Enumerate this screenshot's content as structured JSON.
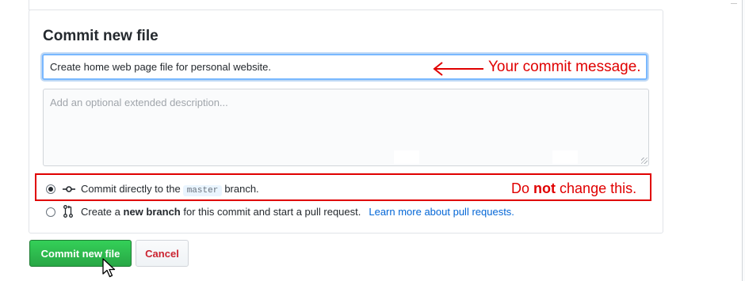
{
  "form": {
    "title": "Commit new file",
    "message_value": "Create home web page file for personal website.",
    "description_placeholder": "Add an optional extended description..."
  },
  "options": {
    "direct": {
      "prefix": "Commit directly to the",
      "branch": "master",
      "suffix": "branch."
    },
    "new_branch": {
      "prefix": "Create a",
      "bold": "new branch",
      "suffix": "for this commit and start a pull request.",
      "link": "Learn more about pull requests."
    }
  },
  "buttons": {
    "commit": "Commit new file",
    "cancel": "Cancel"
  },
  "annotations": {
    "commit_message": "Your commit message.",
    "warning_prefix": "Do",
    "warning_bold": "not",
    "warning_suffix": "change this.",
    "color": "#e00000"
  },
  "icons": {
    "direct": "git-commit-icon",
    "new_branch": "git-pull-request-icon",
    "arrow": "arrow-left-icon",
    "cursor": "mouse-pointer-icon"
  }
}
